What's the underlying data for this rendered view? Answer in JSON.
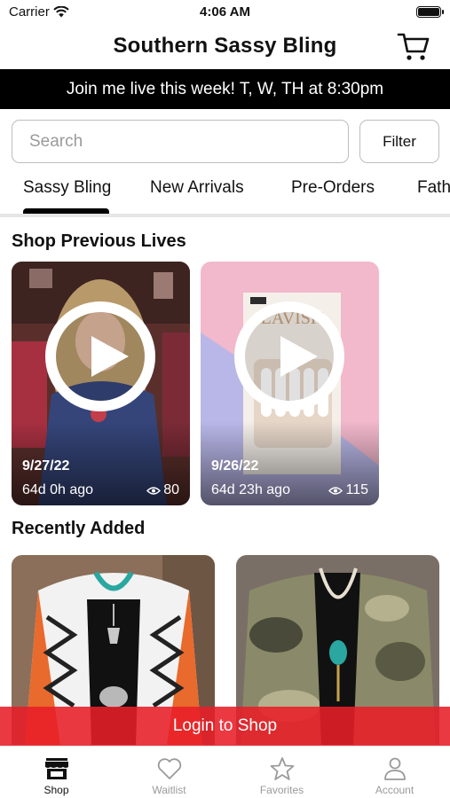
{
  "status_bar": {
    "carrier": "Carrier",
    "time": "4:06 AM"
  },
  "header": {
    "title": "Southern Sassy Bling",
    "cart_icon": "cart-icon"
  },
  "banner": {
    "text": "Join me live this week! T, W, TH at 8:30pm"
  },
  "search": {
    "placeholder": "Search",
    "value": "",
    "filter_label": "Filter"
  },
  "tabs": [
    {
      "label": "Sassy Bling",
      "active": true
    },
    {
      "label": "New Arrivals",
      "active": false
    },
    {
      "label": "Pre-Orders",
      "active": false
    },
    {
      "label": "Fath",
      "active": false
    }
  ],
  "previous_lives": {
    "title": "Shop Previous Lives",
    "items": [
      {
        "date": "9/27/22",
        "ago": "64d 0h ago",
        "views": "80"
      },
      {
        "date": "9/26/22",
        "ago": "64d 23h ago",
        "views": "115"
      }
    ]
  },
  "recently_added": {
    "title": "Recently Added"
  },
  "login_bar": {
    "label": "Login to Shop"
  },
  "tabbar": [
    {
      "label": "Shop",
      "icon": "storefront-icon",
      "active": true
    },
    {
      "label": "Waitlist",
      "icon": "heart-icon",
      "active": false
    },
    {
      "label": "Favorites",
      "icon": "star-icon",
      "active": false
    },
    {
      "label": "Account",
      "icon": "person-icon",
      "active": false
    }
  ],
  "colors": {
    "accent": "#e81e28",
    "banner_bg": "#000000",
    "active": "#111111",
    "inactive": "#9a9a9a"
  }
}
